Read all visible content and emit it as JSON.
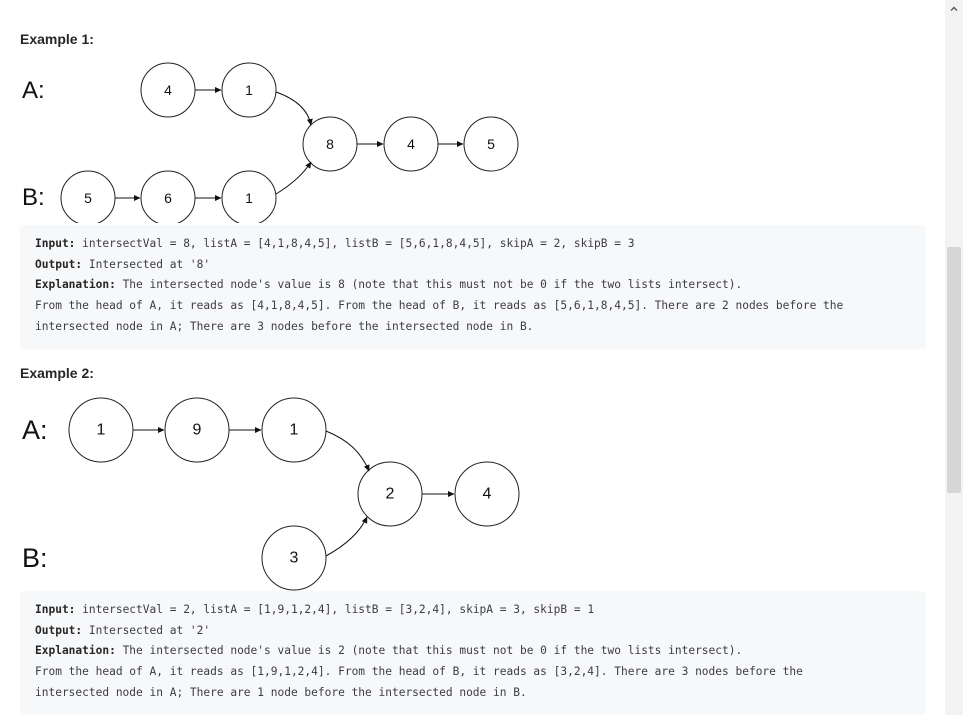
{
  "examples": [
    {
      "title": "Example 1:",
      "diagram": {
        "label_a": "A:",
        "label_b": "B:",
        "nodes_a": [
          "4",
          "1"
        ],
        "nodes_b": [
          "5",
          "6",
          "1"
        ],
        "nodes_shared": [
          "8",
          "4",
          "5"
        ]
      },
      "code": {
        "input_key": "Input:",
        "input_value": " intersectVal = 8, listA = [4,1,8,4,5], listB = [5,6,1,8,4,5], skipA = 2, skipB = 3",
        "output_key": "Output:",
        "output_value": " Intersected at '8'",
        "explanation_key": "Explanation:",
        "explanation_value": " The intersected node's value is 8 (note that this must not be 0 if the two lists intersect).",
        "explanation_line2": "From the head of A, it reads as [4,1,8,4,5]. From the head of B, it reads as [5,6,1,8,4,5]. There are 2 nodes before the",
        "explanation_line3": "intersected node in A; There are 3 nodes before the intersected node in B."
      }
    },
    {
      "title": "Example 2:",
      "diagram": {
        "label_a": "A:",
        "label_b": "B:",
        "nodes_a": [
          "1",
          "9",
          "1"
        ],
        "nodes_b": [
          "3"
        ],
        "nodes_shared": [
          "2",
          "4"
        ]
      },
      "code": {
        "input_key": "Input:",
        "input_value": " intersectVal = 2, listA = [1,9,1,2,4], listB = [3,2,4], skipA = 3, skipB = 1",
        "output_key": "Output:",
        "output_value": " Intersected at '2'",
        "explanation_key": "Explanation:",
        "explanation_value": " The intersected node's value is 2 (note that this must not be 0 if the two lists intersect).",
        "explanation_line2": "From the head of A, it reads as [1,9,1,2,4]. From the head of B, it reads as [3,2,4]. There are 3 nodes before the",
        "explanation_line3": "intersected node in A; There are 1 node before the intersected node in B."
      }
    }
  ],
  "scrollbar": {
    "up_icon": "chevron-up-icon"
  }
}
